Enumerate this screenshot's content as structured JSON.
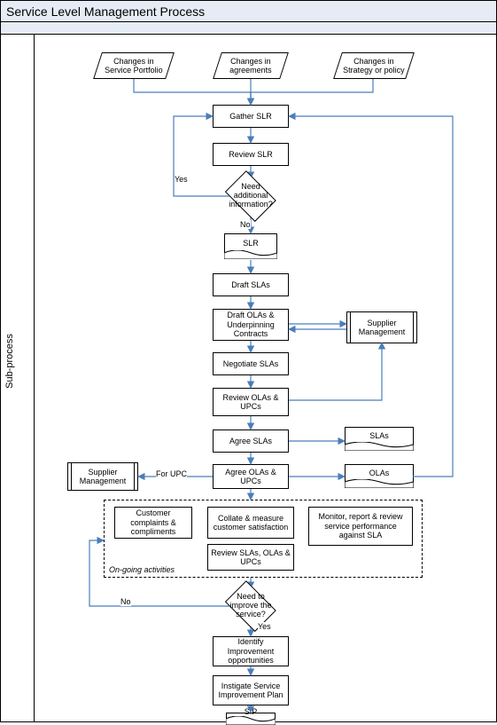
{
  "title": "Service Level Management Process",
  "swimlane": "Sub-process",
  "inputs": {
    "portfolio": "Changes in Service Portfolio",
    "agreements": "Changes in agreements",
    "strategy": "Changes in Strategy or policy"
  },
  "steps": {
    "gather": "Gather SLR",
    "review_slr": "Review SLR",
    "need_info": "Need additional information?",
    "slr_doc": "SLR",
    "draft_slas": "Draft SLAs",
    "draft_olas": "Draft OLAs & Underpinning Contracts",
    "negotiate": "Negotiate SLAs",
    "review_ola": "Review OLAs & UPCs",
    "agree_slas": "Agree SLAs",
    "agree_olas": "Agree OLAs & UPCs",
    "supplier_mgmt": "Supplier Management",
    "supplier_mgmt2": "Supplier Management",
    "slas_doc": "SLAs",
    "olas_doc": "OLAs",
    "complaints": "Customer complaints & compliments",
    "collate": "Collate & measure customer satisfaction",
    "monitor": "Monitor, report & review service performance against SLA",
    "review_all": "Review SLAs, OLAs & UPCs",
    "ongoing_label": "On-going activities",
    "need_improve": "Need to improve the service?",
    "identify": "Identify Improvement opportunities",
    "instigate": "Instigate Service Improvement Plan",
    "sip_doc": "SIP"
  },
  "labels": {
    "yes": "Yes",
    "no": "No",
    "for_upc": "For UPC"
  },
  "chart_data": {
    "type": "flowchart",
    "title": "Service Level Management Process",
    "swimlane": "Sub-process",
    "inputs": [
      "Changes in Service Portfolio",
      "Changes in agreements",
      "Changes in Strategy or policy"
    ],
    "nodes": [
      {
        "id": "gather",
        "type": "process",
        "label": "Gather SLR"
      },
      {
        "id": "review_slr",
        "type": "process",
        "label": "Review SLR"
      },
      {
        "id": "need_info",
        "type": "decision",
        "label": "Need additional information?"
      },
      {
        "id": "slr_doc",
        "type": "document",
        "label": "SLR"
      },
      {
        "id": "draft_slas",
        "type": "process",
        "label": "Draft SLAs"
      },
      {
        "id": "draft_olas",
        "type": "process",
        "label": "Draft OLAs & Underpinning Contracts"
      },
      {
        "id": "supplier_mgmt",
        "type": "predefined",
        "label": "Supplier Management"
      },
      {
        "id": "negotiate",
        "type": "process",
        "label": "Negotiate SLAs"
      },
      {
        "id": "review_ola",
        "type": "process",
        "label": "Review OLAs & UPCs"
      },
      {
        "id": "agree_slas",
        "type": "process",
        "label": "Agree SLAs"
      },
      {
        "id": "slas_doc",
        "type": "document",
        "label": "SLAs"
      },
      {
        "id": "agree_olas",
        "type": "process",
        "label": "Agree OLAs & UPCs"
      },
      {
        "id": "olas_doc",
        "type": "document",
        "label": "OLAs"
      },
      {
        "id": "supplier_mgmt2",
        "type": "predefined",
        "label": "Supplier Management"
      },
      {
        "id": "complaints",
        "type": "process",
        "label": "Customer complaints & compliments",
        "group": "ongoing"
      },
      {
        "id": "collate",
        "type": "process",
        "label": "Collate & measure customer satisfaction",
        "group": "ongoing"
      },
      {
        "id": "monitor",
        "type": "process",
        "label": "Monitor, report & review service performance against SLA",
        "group": "ongoing"
      },
      {
        "id": "review_all",
        "type": "process",
        "label": "Review SLAs, OLAs & UPCs",
        "group": "ongoing"
      },
      {
        "id": "need_improve",
        "type": "decision",
        "label": "Need to improve the service?"
      },
      {
        "id": "identify",
        "type": "process",
        "label": "Identify Improvement opportunities"
      },
      {
        "id": "instigate",
        "type": "process",
        "label": "Instigate Service Improvement Plan"
      },
      {
        "id": "sip_doc",
        "type": "document",
        "label": "SIP"
      }
    ],
    "edges": [
      {
        "from": "Changes in Service Portfolio",
        "to": "gather"
      },
      {
        "from": "Changes in agreements",
        "to": "gather"
      },
      {
        "from": "Changes in Strategy or policy",
        "to": "gather"
      },
      {
        "from": "gather",
        "to": "review_slr"
      },
      {
        "from": "review_slr",
        "to": "need_info"
      },
      {
        "from": "need_info",
        "to": "gather",
        "label": "Yes"
      },
      {
        "from": "need_info",
        "to": "slr_doc",
        "label": "No"
      },
      {
        "from": "slr_doc",
        "to": "draft_slas"
      },
      {
        "from": "draft_slas",
        "to": "draft_olas"
      },
      {
        "from": "draft_olas",
        "to": "supplier_mgmt",
        "bidirectional": true
      },
      {
        "from": "draft_olas",
        "to": "negotiate"
      },
      {
        "from": "negotiate",
        "to": "review_ola"
      },
      {
        "from": "review_ola",
        "to": "supplier_mgmt"
      },
      {
        "from": "review_ola",
        "to": "agree_slas"
      },
      {
        "from": "agree_slas",
        "to": "slas_doc"
      },
      {
        "from": "agree_slas",
        "to": "agree_olas"
      },
      {
        "from": "agree_olas",
        "to": "olas_doc"
      },
      {
        "from": "agree_olas",
        "to": "supplier_mgmt2",
        "label": "For UPC"
      },
      {
        "from": "olas_doc",
        "to": "gather",
        "note": "feedback to start"
      },
      {
        "from": "agree_olas",
        "to": "ongoing"
      },
      {
        "from": "ongoing",
        "to": "need_improve"
      },
      {
        "from": "need_improve",
        "to": "ongoing",
        "label": "No"
      },
      {
        "from": "need_improve",
        "to": "identify",
        "label": "Yes"
      },
      {
        "from": "identify",
        "to": "instigate"
      },
      {
        "from": "instigate",
        "to": "sip_doc"
      }
    ],
    "groups": [
      {
        "id": "ongoing",
        "label": "On-going activities",
        "members": [
          "complaints",
          "collate",
          "monitor",
          "review_all"
        ]
      }
    ]
  }
}
